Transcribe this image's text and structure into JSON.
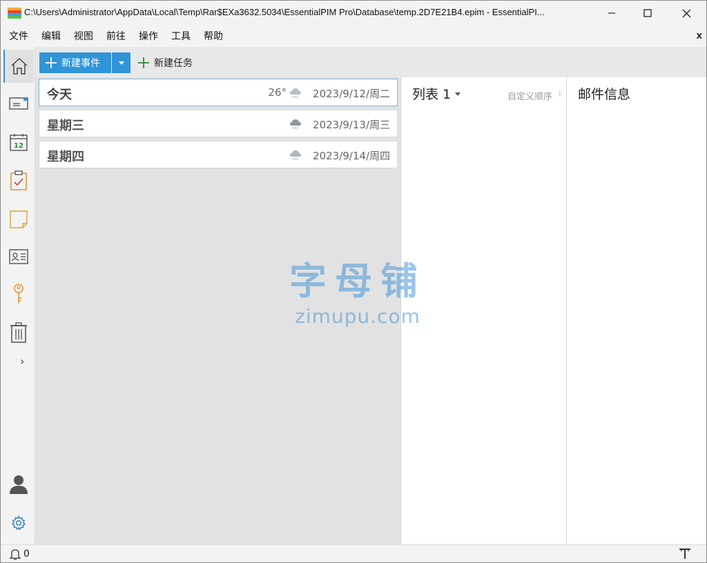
{
  "window": {
    "title": "C:\\Users\\Administrator\\AppData\\Local\\Temp\\Rar$EXa3632.5034\\EssentialPIM Pro\\Database\\temp.2D7E21B4.epim - EssentialPI..."
  },
  "menu": {
    "items": [
      "文件",
      "编辑",
      "视图",
      "前往",
      "操作",
      "工具",
      "帮助"
    ],
    "close_label": "x"
  },
  "toolbar": {
    "new_event_label": "新建事件",
    "new_task_label": "新建任务",
    "accent_color": "#2f95d8"
  },
  "days": [
    {
      "name": "今天",
      "temp": "26°",
      "weather": "rain-cloud-icon",
      "date": "2023/9/12/周二"
    },
    {
      "name": "星期三",
      "temp": "",
      "weather": "rain-cloud-icon",
      "date": "2023/9/13/周三"
    },
    {
      "name": "星期四",
      "temp": "",
      "weather": "rain-cloud-icon",
      "date": "2023/9/14/周四"
    }
  ],
  "list_panel": {
    "title": "列表 1",
    "sort_label": "自定义顺序",
    "more_label": "⁝"
  },
  "mail_panel": {
    "title": "邮件信息"
  },
  "status": {
    "notification_count": "0"
  },
  "watermark": {
    "cn": "字母铺",
    "en": "zimupu.com"
  }
}
